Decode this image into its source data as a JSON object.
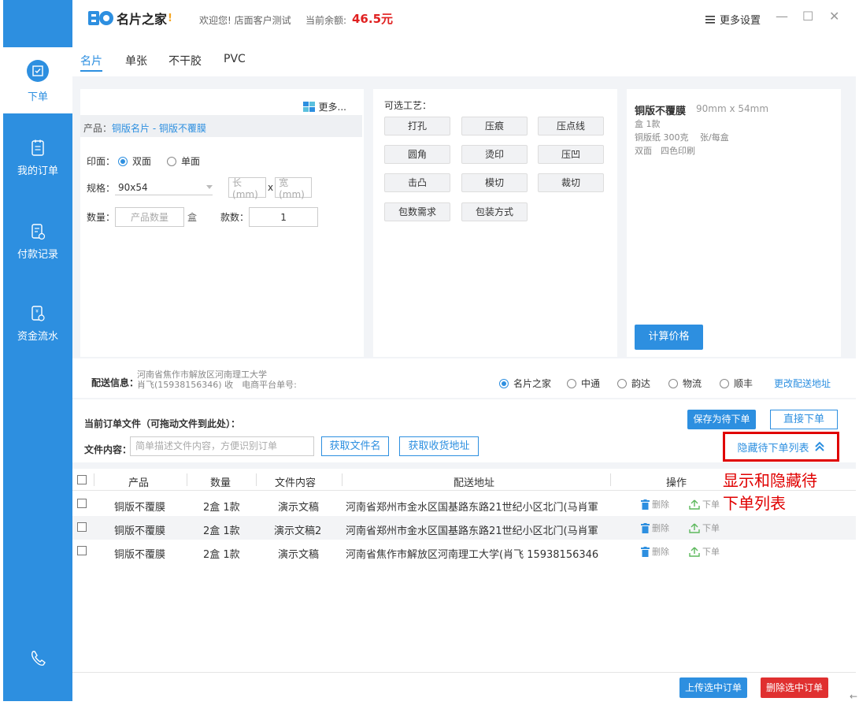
{
  "app": {
    "logo_text": "名片之家",
    "welcome": "欢迎您! 店面客户测试",
    "balance_label": "当前余额:",
    "balance_value": "46.5元",
    "settings_label": "更多设置"
  },
  "sidebar": {
    "items": [
      {
        "label": "下单",
        "icon": "edit-check-icon",
        "active": true
      },
      {
        "label": "我的订单",
        "icon": "order-list-icon",
        "active": false
      },
      {
        "label": "付款记录",
        "icon": "payment-record-icon",
        "active": false
      },
      {
        "label": "资金流水",
        "icon": "fund-flow-icon",
        "active": false
      }
    ]
  },
  "tabs": [
    "名片",
    "单张",
    "不干胶",
    "PVC"
  ],
  "product": {
    "more_label": "更多...",
    "product_label": "产品：",
    "product_value": "铜版名片 - 铜版不覆膜",
    "print_label": "印面：",
    "print_options": [
      "双面",
      "单面"
    ],
    "print_selected": "双面",
    "spec_label": "规格：",
    "spec_value": "90x54",
    "length_placeholder": "长(mm)",
    "times": "x",
    "width_placeholder": "宽(mm)",
    "qty_label": "数量：",
    "qty_placeholder": "产品数量",
    "qty_unit": "盒",
    "kinds_label": "款数：",
    "kinds_value": "1"
  },
  "craft": {
    "title": "可选工艺：",
    "buttons": [
      "打孔",
      "压痕",
      "压点线",
      "圆角",
      "烫印",
      "压凹",
      "击凸",
      "模切",
      "裁切",
      "包数需求",
      "包装方式"
    ]
  },
  "summary": {
    "name": "铜版不覆膜",
    "size": "90mm x 54mm",
    "line1": "盒 1款",
    "line2": "铜版纸 300克　 张/每盒",
    "line3": "双面　四色印刷",
    "calc_label": "计算价格"
  },
  "delivery": {
    "label": "配送信息：",
    "address_line1": "河南省焦作市解放区河南理工大学",
    "address_line2": "肖飞(15938156346) 收　电商平台单号:",
    "carriers": [
      "名片之家",
      "中通",
      "韵达",
      "物流",
      "顺丰"
    ],
    "carrier_selected": "名片之家",
    "change_label": "更改配送地址"
  },
  "files": {
    "title": "当前订单文件（可拖动文件到此处）：",
    "content_label": "文件内容：",
    "content_placeholder": "简单描述文件内容，方便识别订单",
    "get_filename": "获取文件名",
    "get_address": "获取收货地址",
    "save_pending": "保存为待下单",
    "direct_order": "直接下单",
    "toggle_list": "隐藏待下单列表"
  },
  "table": {
    "headers": [
      "产品",
      "数量",
      "文件内容",
      "配送地址",
      "操作"
    ],
    "rows": [
      {
        "product": "铜版不覆膜",
        "qty": "2盒 1款",
        "content": "演示文稿",
        "address": "河南省郑州市金水区国基路东路21世纪小区北门(马肖軍",
        "delete": "删除",
        "order": "下单"
      },
      {
        "product": "铜版不覆膜",
        "qty": "2盒 1款",
        "content": "演示文稿2",
        "address": "河南省郑州市金水区国基路东路21世纪小区北门(马肖軍",
        "delete": "删除",
        "order": "下单"
      },
      {
        "product": "铜版不覆膜",
        "qty": "2盒 1款",
        "content": "演示文稿",
        "address": "河南省焦作市解放区河南理工大学(肖飞 15938156346",
        "delete": "删除",
        "order": "下单"
      }
    ]
  },
  "annotation": {
    "line1": "显示和隐藏待",
    "line2": "下单列表"
  },
  "footer": {
    "upload_selected": "上传选中订单",
    "delete_selected": "删除选中订单"
  },
  "colors": {
    "brand_blue": "#2d8fe0",
    "danger_red": "#e03030",
    "price_red": "#e02020"
  }
}
